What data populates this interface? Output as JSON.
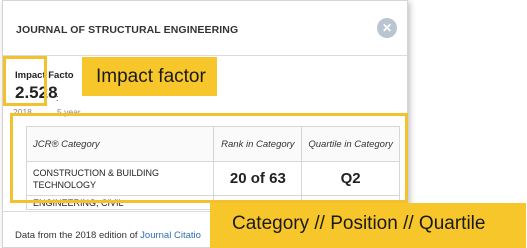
{
  "panel": {
    "journal_title": "JOURNAL OF STRUCTURAL ENGINEERING",
    "close_icon": "x-icon"
  },
  "impact": {
    "label": "Impact Facto",
    "value": "2.528",
    "five_year_value": ":",
    "year": "2018",
    "five_year_label": "5 year"
  },
  "table": {
    "headers": [
      "JCR® Category",
      "Rank in Category",
      "Quartile in Category"
    ],
    "rows": [
      {
        "category": "CONSTRUCTION & BUILDING TECHNOLOGY",
        "rank": "20 of 63",
        "quartile": "Q2"
      },
      {
        "category": "ENGINEERING, CIVIL",
        "rank": "",
        "quartile": ""
      }
    ]
  },
  "footer": {
    "prefix": "Data from the 2018 edition of ",
    "link": "Journal Citatio"
  },
  "annotations": {
    "impact_factor": "Impact factor",
    "category_position_quartile": "Category // Position // Quartile",
    "color": "#f7c62b"
  }
}
